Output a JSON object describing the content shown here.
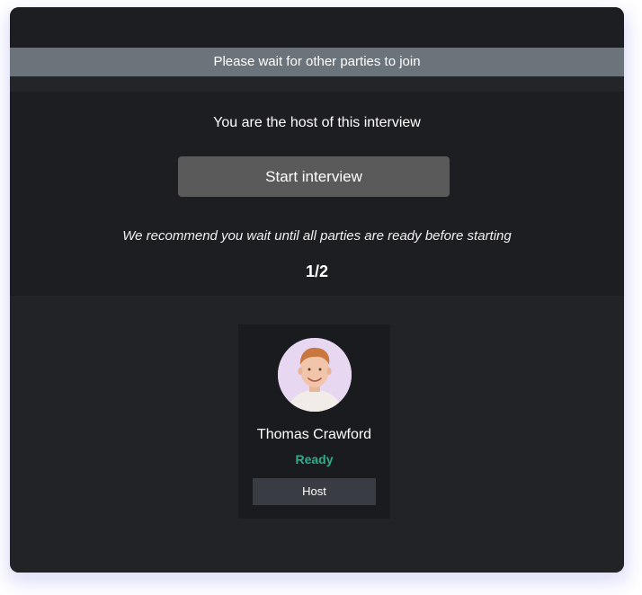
{
  "banner": {
    "text": "Please wait for other parties to join"
  },
  "host_panel": {
    "title": "You are the host of this interview",
    "start_button_label": "Start interview",
    "recommendation": "We recommend you wait until all parties are ready before starting",
    "count": "1/2"
  },
  "participants": [
    {
      "name": "Thomas Crawford",
      "status": "Ready",
      "role": "Host",
      "avatar_icon": "person-avatar"
    }
  ],
  "colors": {
    "banner_bg": "#6b737b",
    "card_bg": "#1d1e21",
    "button_bg": "#5a5a5a",
    "ready_green": "#2cae8e",
    "role_chip_bg": "#393c42"
  }
}
